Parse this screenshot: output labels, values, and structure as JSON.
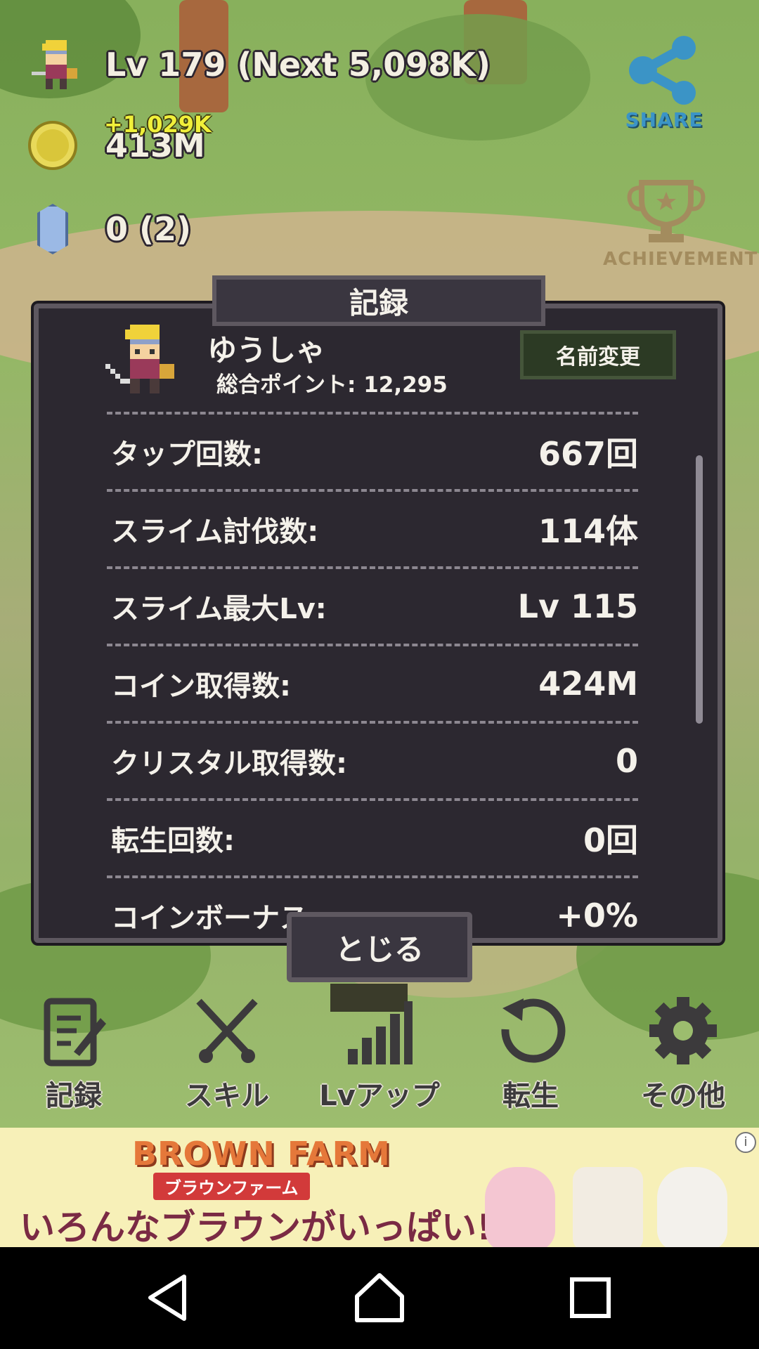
{
  "hud": {
    "level_text": "Lv 179 (Next 5,098K)",
    "coin_gain": "+1,029K",
    "coins": "413M",
    "crystals": "0  (2)"
  },
  "top_right": {
    "share_label": "SHARE",
    "achievement_label": "ACHIEVEMENT"
  },
  "dialog": {
    "title": "記録",
    "player_name": "ゆうしゃ",
    "total_points": "総合ポイント: 12,295",
    "rename_label": "名前変更",
    "stats": [
      {
        "label": "タップ回数:",
        "value": "667回"
      },
      {
        "label": "スライム討伐数:",
        "value": "114体"
      },
      {
        "label": "スライム最大Lv:",
        "value": "Lv 115"
      },
      {
        "label": "コイン取得数:",
        "value": "424M"
      },
      {
        "label": "クリスタル取得数:",
        "value": "0"
      },
      {
        "label": "転生回数:",
        "value": "0回"
      },
      {
        "label": "コインボーナス:",
        "value": "+0%"
      }
    ],
    "close_label": "とじる"
  },
  "menu": [
    {
      "label": "記録",
      "icon": "record-icon"
    },
    {
      "label": "スキル",
      "icon": "crossed-swords-icon"
    },
    {
      "label": "Lvアップ",
      "icon": "level-up-icon"
    },
    {
      "label": "転生",
      "icon": "rebirth-icon"
    },
    {
      "label": "その他",
      "icon": "gear-icon"
    }
  ],
  "ad": {
    "logo": "BROWN FARM",
    "subtitle": "ブラウンファーム",
    "text": "いろんなブラウンがいっぱい!",
    "info": "i"
  },
  "colors": {
    "panel": "#2c2830",
    "panel_border": "#5e5860",
    "share_blue": "#3b94c6",
    "coin_gain_yellow": "#f0f03a"
  }
}
